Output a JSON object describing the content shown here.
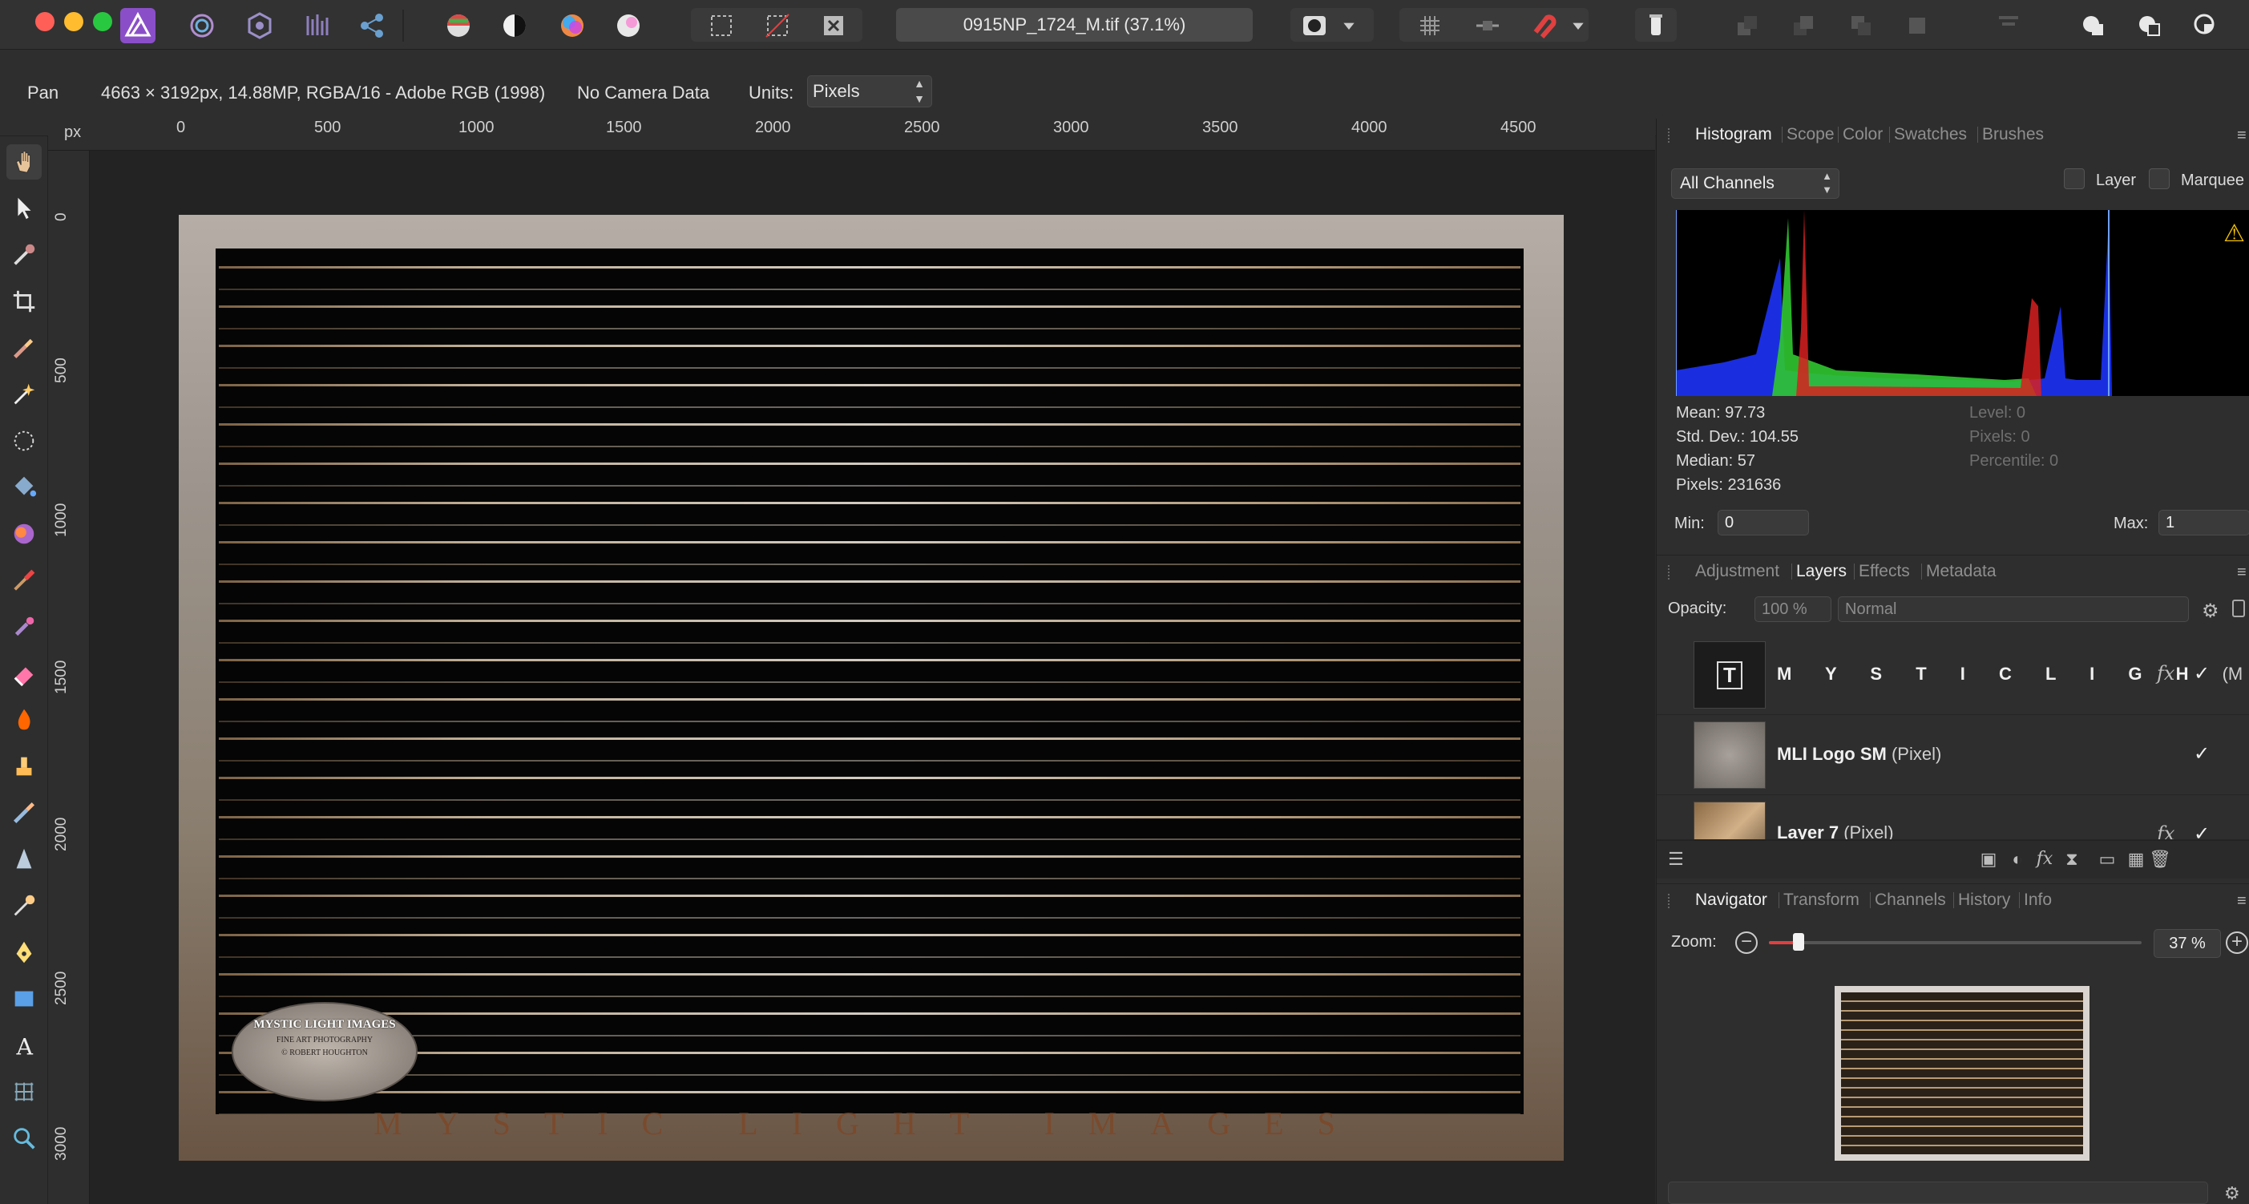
{
  "window": {
    "document_title": "0915NP_1724_M.tif (37.1%)",
    "traffic_colors": [
      "#ff5f57",
      "#febc2e",
      "#28c840"
    ]
  },
  "context_bar": {
    "tool_name": "Pan",
    "image_info": "4663 × 3192px, 14.88MP, RGBA/16 - Adobe RGB (1998)",
    "camera_info": "No Camera Data",
    "units_label": "Units:",
    "units_value": "Pixels"
  },
  "rulers": {
    "unit": "px",
    "top_labels": [
      "0",
      "500",
      "1000",
      "1500",
      "2000",
      "2500",
      "3000",
      "3500",
      "4000",
      "4500"
    ],
    "left_labels": [
      "0",
      "500",
      "1000",
      "1500",
      "2000",
      "2500",
      "3000"
    ]
  },
  "canvas": {
    "watermark_title": "MYSTIC LIGHT IMAGES",
    "watermark_sub": "FINE ART PHOTOGRAPHY",
    "watermark_name": "© ROBERT HOUGHTON",
    "brand_line": "MYSTIC LIGHT IMAGES"
  },
  "histogram_panel": {
    "tabs": [
      "Histogram",
      "Scope",
      "Color",
      "Swatches",
      "Brushes"
    ],
    "active_tab": "Histogram",
    "channel": "All Channels",
    "layer_label": "Layer",
    "marquee_label": "Marquee",
    "mean": "Mean: 97.73",
    "std_dev": "Std. Dev.: 104.55",
    "median": "Median: 57",
    "pixels": "Pixels: 231636",
    "level": "Level: 0",
    "pixels_sel": "Pixels: 0",
    "percentile": "Percentile: 0",
    "min_label": "Min:",
    "min_value": "0",
    "max_label": "Max:",
    "max_value": "1"
  },
  "layers_panel": {
    "tabs": [
      "Adjustment",
      "Layers",
      "Effects",
      "Metadata"
    ],
    "active_tab": "Layers",
    "opacity_label": "Opacity:",
    "opacity_value": "100 %",
    "blend_mode": "Normal",
    "layers": [
      {
        "name": "M Y S T I C   L I G H",
        "kind": "(M",
        "fx": "fx",
        "visible": "✓"
      },
      {
        "name": "MLI Logo SM",
        "kind": "(Pixel)",
        "fx": "",
        "visible": "✓"
      },
      {
        "name": "Layer 7",
        "kind": "(Pixel)",
        "fx": "fx",
        "visible": "✓"
      }
    ]
  },
  "navigator_panel": {
    "tabs": [
      "Navigator",
      "Transform",
      "Channels",
      "History",
      "Info"
    ],
    "active_tab": "Navigator",
    "zoom_label": "Zoom:",
    "zoom_value": "37 %",
    "zoom_fraction": 0.08
  },
  "colors": {
    "accent": "#e04040",
    "panel_bg": "#2e2e2e",
    "active_text": "#f0f0f0",
    "inactive_text": "#8f8f8f"
  }
}
